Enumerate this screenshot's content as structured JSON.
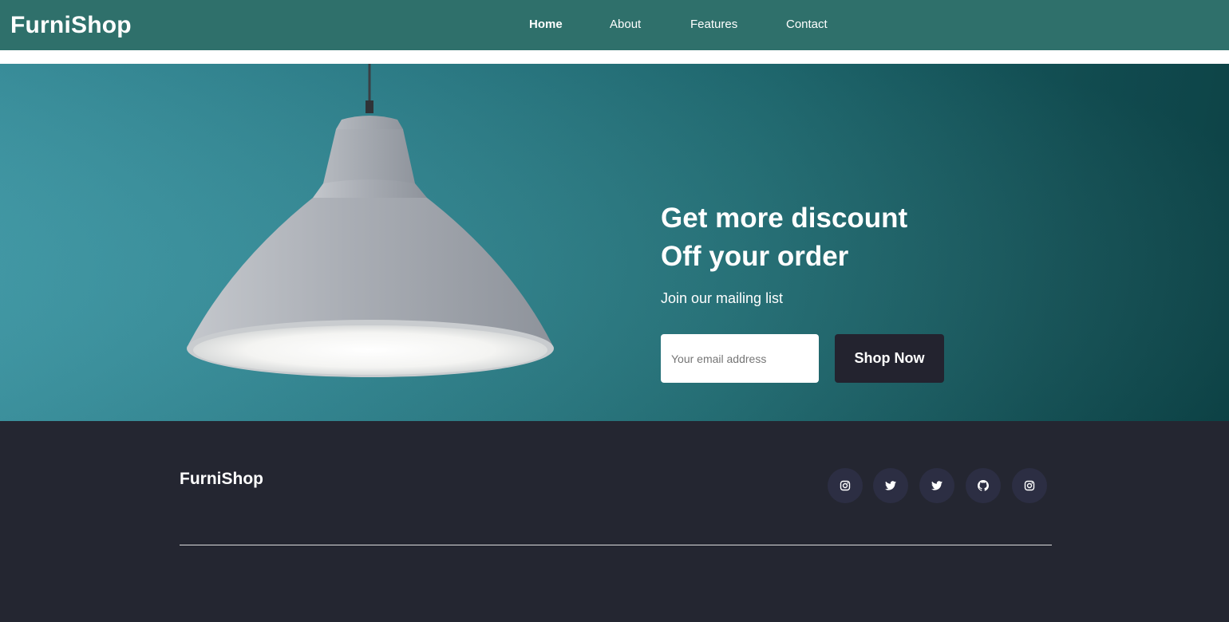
{
  "navbar": {
    "brand": "FurniShop",
    "links": [
      {
        "label": "Home",
        "active": true
      },
      {
        "label": "About",
        "active": false
      },
      {
        "label": "Features",
        "active": false
      },
      {
        "label": "Contact",
        "active": false
      }
    ]
  },
  "hero": {
    "title_line1": "Get more discount",
    "title_line2": "Off your order",
    "subtitle": "Join our mailing list",
    "email_placeholder": "Your email address",
    "button_label": "Shop Now"
  },
  "footer": {
    "brand": "FurniShop",
    "social": [
      {
        "icon": "instagram-icon"
      },
      {
        "icon": "twitter-icon"
      },
      {
        "icon": "twitter-icon"
      },
      {
        "icon": "github-icon"
      },
      {
        "icon": "instagram-icon"
      }
    ]
  },
  "colors": {
    "navbar": "#2f706b",
    "hero_teal": "#2a828e",
    "footer": "#242631",
    "button": "#23232f",
    "social_circle": "#2c2e43"
  }
}
